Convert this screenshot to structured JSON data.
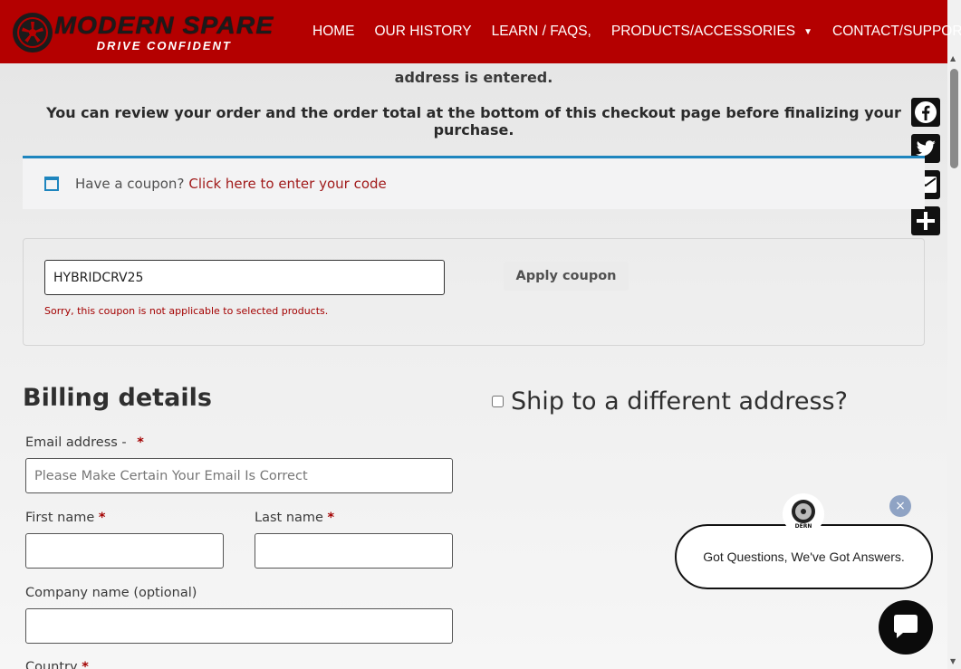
{
  "header": {
    "logo_main": "MODERN SPARE",
    "logo_sub": "DRIVE CONFIDENT",
    "nav": [
      {
        "label": "HOME",
        "caret": false
      },
      {
        "label": "OUR HISTORY",
        "caret": false
      },
      {
        "label": "LEARN / FAQS,",
        "caret": false
      },
      {
        "label": "PRODUCTS/ACCESSORIES",
        "caret": true
      },
      {
        "label": "CONTACT/SUPPORT",
        "caret": true
      }
    ],
    "caret_glyph": "▼"
  },
  "intro": {
    "line1": "address is entered.",
    "line2": "You can review your order and the order total at the bottom of this checkout page before finalizing your purchase."
  },
  "share": {
    "facebook": "f",
    "twitter": "t",
    "email": "✉",
    "more": "+"
  },
  "coupon_notice": {
    "text": "Have a coupon?",
    "link": "Click here to enter your code"
  },
  "coupon_form": {
    "code_value": "HYBRIDCRV25",
    "error": "Sorry, this coupon is not applicable to selected products.",
    "apply_label": "Apply coupon"
  },
  "billing": {
    "title": "Billing details",
    "email_label": "Email address -",
    "email_placeholder": "Please Make Certain Your Email Is Correct",
    "first_name_label": "First name",
    "last_name_label": "Last name",
    "company_label": "Company name (optional)",
    "country_label": "Country",
    "required_mark": "*"
  },
  "shipping": {
    "ship_label": "Ship to a different address?"
  },
  "chat": {
    "close": "×",
    "message": "Got Questions, We've Got Answers.",
    "avatar_text": "DERN"
  },
  "colors": {
    "header_bg": "#b40000",
    "link": "#a11b1b",
    "notice_accent": "#1e85be",
    "error": "#a30000"
  },
  "icons": [
    "wheel-logo-icon",
    "caret-down-icon",
    "facebook-icon",
    "twitter-icon",
    "email-icon",
    "share-plus-icon",
    "notice-window-icon",
    "chat-close-icon",
    "chat-bubble-icon"
  ]
}
